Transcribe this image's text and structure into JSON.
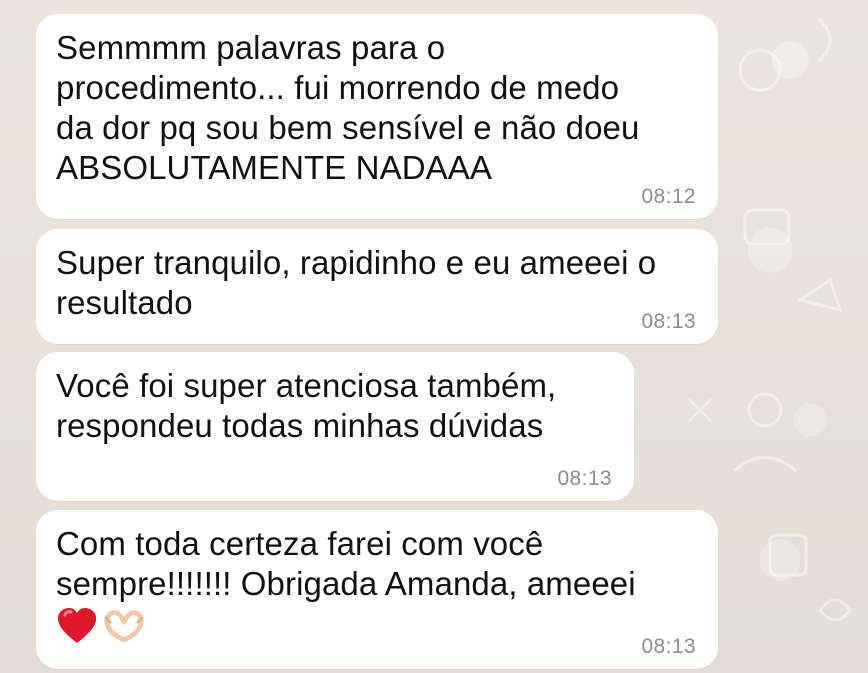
{
  "messages": [
    {
      "text": "Semmmm palavras para o\nprocedimento... fui morrendo de medo\nda dor pq sou bem sensível e não doeu\nABSOLUTAMENTE NADAAA",
      "time": "08:12"
    },
    {
      "text": "Super tranquilo, rapidinho e eu ameeei o\nresultado",
      "time": "08:13"
    },
    {
      "text": "Você foi super atenciosa também,\nrespondeu todas minhas dúvidas",
      "time": "08:13"
    },
    {
      "text": "Com toda certeza farei com você\nsempre!!!!!!! Obrigada Amanda, ameeei",
      "emojis": [
        "red-heart-icon",
        "heart-hands-icon"
      ],
      "time": "08:13"
    }
  ],
  "colors": {
    "bubble": "#ffffff",
    "timestamp": "#8d8d8d",
    "heart": "#e0182d",
    "hands": "#f2c9a8"
  }
}
